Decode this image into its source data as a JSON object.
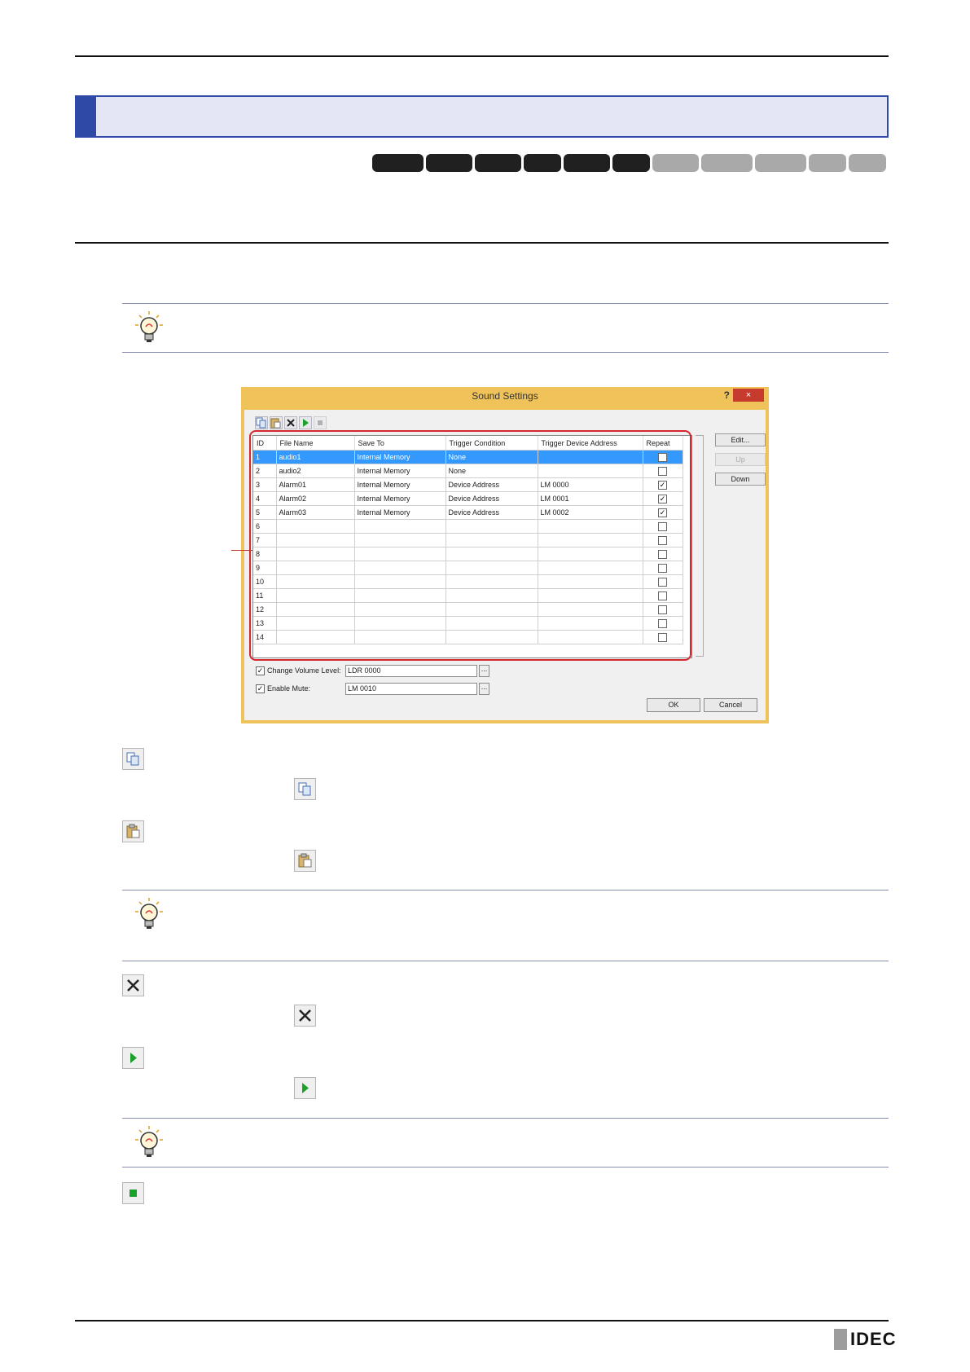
{
  "dialog": {
    "title": "Sound Settings",
    "help": "?",
    "close": "×",
    "columns": [
      "ID",
      "File Name",
      "Save To",
      "Trigger Condition",
      "Trigger Device Address",
      "Repeat"
    ],
    "rows": [
      {
        "id": "1",
        "file": "audio1",
        "save": "Internal Memory",
        "cond": "None",
        "addr": "",
        "repeat": false,
        "selected": true
      },
      {
        "id": "2",
        "file": "audio2",
        "save": "Internal Memory",
        "cond": "None",
        "addr": "",
        "repeat": false
      },
      {
        "id": "3",
        "file": "Alarm01",
        "save": "Internal Memory",
        "cond": "Device Address",
        "addr": "LM 0000",
        "repeat": true
      },
      {
        "id": "4",
        "file": "Alarm02",
        "save": "Internal Memory",
        "cond": "Device Address",
        "addr": "LM 0001",
        "repeat": true
      },
      {
        "id": "5",
        "file": "Alarm03",
        "save": "Internal Memory",
        "cond": "Device Address",
        "addr": "LM 0002",
        "repeat": true
      },
      {
        "id": "6",
        "file": "",
        "save": "",
        "cond": "",
        "addr": "",
        "repeat": false
      },
      {
        "id": "7",
        "file": "",
        "save": "",
        "cond": "",
        "addr": "",
        "repeat": false
      },
      {
        "id": "8",
        "file": "",
        "save": "",
        "cond": "",
        "addr": "",
        "repeat": false
      },
      {
        "id": "9",
        "file": "",
        "save": "",
        "cond": "",
        "addr": "",
        "repeat": false
      },
      {
        "id": "10",
        "file": "",
        "save": "",
        "cond": "",
        "addr": "",
        "repeat": false
      },
      {
        "id": "11",
        "file": "",
        "save": "",
        "cond": "",
        "addr": "",
        "repeat": false
      },
      {
        "id": "12",
        "file": "",
        "save": "",
        "cond": "",
        "addr": "",
        "repeat": false
      },
      {
        "id": "13",
        "file": "",
        "save": "",
        "cond": "",
        "addr": "",
        "repeat": false
      },
      {
        "id": "14",
        "file": "",
        "save": "",
        "cond": "",
        "addr": "",
        "repeat": false
      }
    ],
    "edit_label": "Edit...",
    "up_label": "Up",
    "down_label": "Down",
    "change_volume_label": "Change Volume Level:",
    "change_volume_value": "LDR 0000",
    "enable_mute_label": "Enable Mute:",
    "enable_mute_value": "LM 0010",
    "browse_label": "...",
    "ok_label": "OK",
    "cancel_label": "Cancel"
  },
  "footer": {
    "logo": "IDEC"
  },
  "colors": {
    "title_band_fill": "#e4e6f6",
    "title_band_accent": "#2e49a6",
    "chip_dark": "#202020",
    "chip_light": "#a9a9a9",
    "dialog_frame": "#f0c35a",
    "highlight_outline": "#d6262e",
    "selection": "#3399ff"
  },
  "icons": [
    "lightbulb-tip-icon",
    "copy-icon",
    "paste-icon",
    "delete-icon",
    "play-icon",
    "stop-icon"
  ]
}
